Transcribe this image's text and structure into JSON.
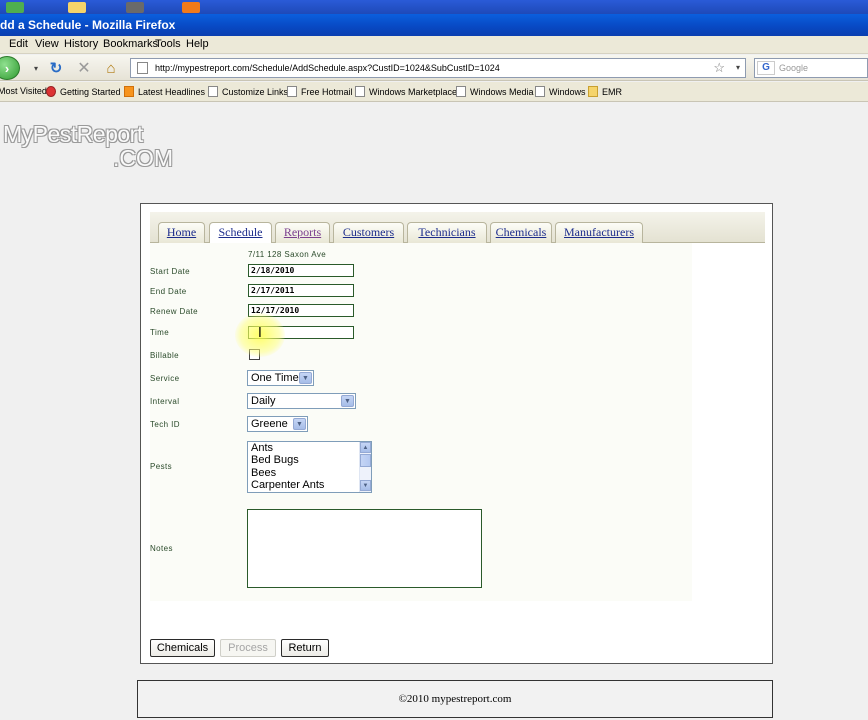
{
  "window": {
    "title": "dd a Schedule - Mozilla Firefox"
  },
  "menu": {
    "edit": "Edit",
    "view": "View",
    "history": "History",
    "bookmarks": "Bookmarks",
    "tools": "Tools",
    "help": "Help"
  },
  "nav": {
    "url": "http://mypestreport.com/Schedule/AddSchedule.aspx?CustID=1024&SubCustID=1024",
    "search_placeholder": "Google"
  },
  "bookmarks_bar": [
    {
      "label": "Most Visited",
      "icon": "none"
    },
    {
      "label": "Getting Started",
      "icon": "ff"
    },
    {
      "label": "Latest Headlines",
      "icon": "rss"
    },
    {
      "label": "Customize Links",
      "icon": "page"
    },
    {
      "label": "Free Hotmail",
      "icon": "page"
    },
    {
      "label": "Windows Marketplace",
      "icon": "page"
    },
    {
      "label": "Windows Media",
      "icon": "page"
    },
    {
      "label": "Windows",
      "icon": "page"
    },
    {
      "label": "EMR",
      "icon": "folder"
    }
  ],
  "logo": {
    "main": "MyPestReport",
    "suffix": ".COM"
  },
  "tabs": [
    {
      "label": "Home",
      "state": "normal"
    },
    {
      "label": "Schedule",
      "state": "active"
    },
    {
      "label": "Reports",
      "state": "visited"
    },
    {
      "label": "Customers",
      "state": "normal"
    },
    {
      "label": "Technicians",
      "state": "normal"
    },
    {
      "label": "Chemicals",
      "state": "normal"
    },
    {
      "label": "Manufacturers",
      "state": "normal"
    }
  ],
  "form": {
    "address": "7/11 128 Saxon Ave",
    "start_date_label": "Start Date",
    "start_date_value": "2/18/2010",
    "end_date_label": "End Date",
    "end_date_value": "2/17/2011",
    "renew_date_label": "Renew Date",
    "renew_date_value": "12/17/2010",
    "time_label": "Time",
    "time_value": "",
    "billable_label": "Billable",
    "service_label": "Service",
    "service_value": "One Time",
    "interval_label": "Interval",
    "interval_value": "Daily",
    "tech_label": "Tech ID",
    "tech_value": "Greene",
    "pests_label": "Pests",
    "pests_options": [
      "Ants",
      "Bed Bugs",
      "Bees",
      "Carpenter Ants"
    ],
    "notes_label": "Notes"
  },
  "buttons": {
    "chemicals": "Chemicals",
    "process": "Process",
    "return": "Return"
  },
  "footer": {
    "text": "©2010 mypestreport.com"
  }
}
